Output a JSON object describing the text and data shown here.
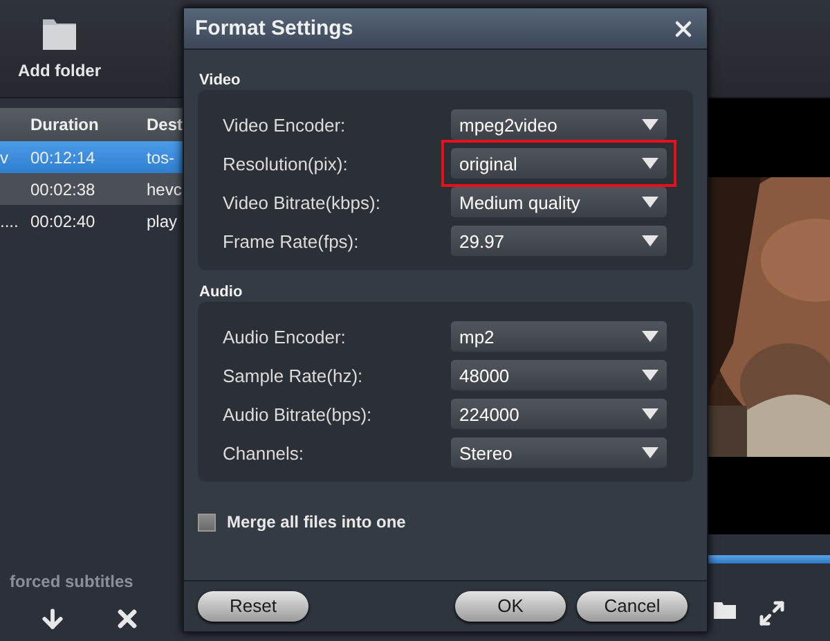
{
  "toolbar": {
    "add_folder": "Add folder"
  },
  "file_table": {
    "columns": [
      {
        "label": "Duration"
      },
      {
        "label": "Dest"
      }
    ],
    "rows": [
      {
        "column_1": "v",
        "duration": "00:12:14",
        "destination": "tos-",
        "selected": true
      },
      {
        "column_1": "",
        "duration": "00:02:38",
        "destination": "hevc",
        "selected": false
      },
      {
        "column_1": "....",
        "duration": "00:02:40",
        "destination": "play",
        "selected": false
      }
    ]
  },
  "bottom_bar": {
    "label": "forced subtitles"
  },
  "dialog": {
    "title": "Format Settings",
    "sections": [
      {
        "title": "Video",
        "fields": [
          {
            "label": "Video Encoder:",
            "value": "mpeg2video",
            "highlighted": false
          },
          {
            "label": "Resolution(pix):",
            "value": "original",
            "highlighted": true
          },
          {
            "label": "Video Bitrate(kbps):",
            "value": "Medium quality",
            "highlighted": false
          },
          {
            "label": "Frame Rate(fps):",
            "value": "29.97",
            "highlighted": false
          }
        ]
      },
      {
        "title": "Audio",
        "fields": [
          {
            "label": "Audio Encoder:",
            "value": "mp2",
            "highlighted": false
          },
          {
            "label": "Sample Rate(hz):",
            "value": "48000",
            "highlighted": false
          },
          {
            "label": "Audio Bitrate(bps):",
            "value": "224000",
            "highlighted": false
          },
          {
            "label": "Channels:",
            "value": "Stereo",
            "highlighted": false
          }
        ]
      }
    ],
    "merge": {
      "label": "Merge all files into one",
      "checked": false
    },
    "buttons": {
      "reset": "Reset",
      "ok": "OK",
      "cancel": "Cancel"
    }
  }
}
